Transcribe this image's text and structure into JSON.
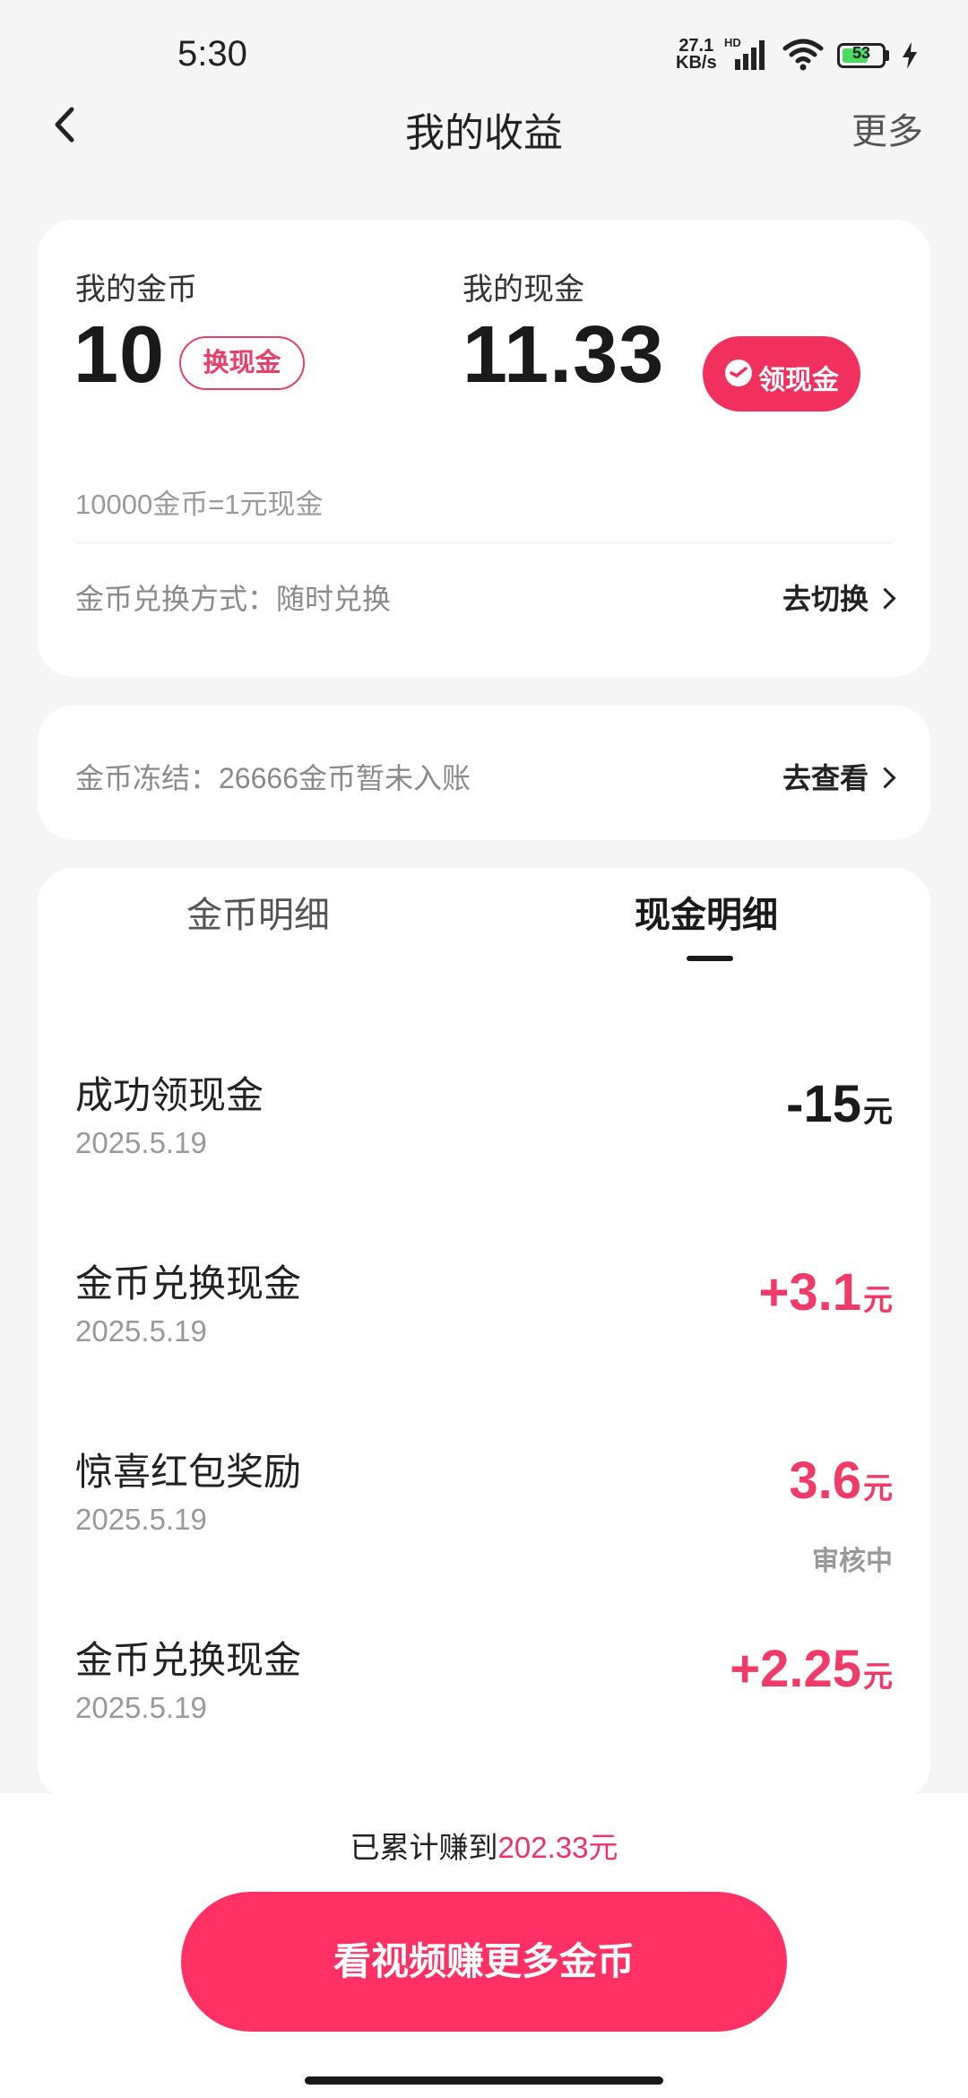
{
  "status_bar": {
    "time": "5:30",
    "net_speed_value": "27.1",
    "net_speed_unit": "KB/s",
    "network_tag": "HD",
    "battery": "53"
  },
  "header": {
    "title": "我的收益",
    "more": "更多"
  },
  "summary": {
    "coins_label": "我的金币",
    "coins_value": "10",
    "coins_action": "换现金",
    "cash_label": "我的现金",
    "cash_value": "11.33",
    "cash_action": "领现金",
    "rate": "10000金币=1元现金",
    "exchange_mode": "金币兑换方式：随时兑换",
    "exchange_link": "去切换"
  },
  "frozen": {
    "text": "金币冻结：26666金币暂未入账",
    "link": "去查看"
  },
  "tabs": [
    {
      "label": "金币明细",
      "active": false
    },
    {
      "label": "现金明细",
      "active": true
    }
  ],
  "transactions": [
    {
      "title": "成功领现金",
      "date": "2025.5.19",
      "amount": "-15",
      "unit": "元",
      "status": ""
    },
    {
      "title": "金币兑换现金",
      "date": "2025.5.19",
      "amount": "+3.1",
      "unit": "元",
      "status": ""
    },
    {
      "title": "惊喜红包奖励",
      "date": "2025.5.19",
      "amount": "3.6",
      "unit": "元",
      "status": "审核中"
    },
    {
      "title": "金币兑换现金",
      "date": "2025.5.19",
      "amount": "+2.25",
      "unit": "元",
      "status": ""
    }
  ],
  "footer": {
    "total_prefix": "已累计赚到",
    "total_amount": "202.33元",
    "cta": "看视频赚更多金币"
  },
  "colors": {
    "accent": "#f2305e",
    "positive_amount": "#f03a68",
    "background": "#f5f5f5"
  }
}
